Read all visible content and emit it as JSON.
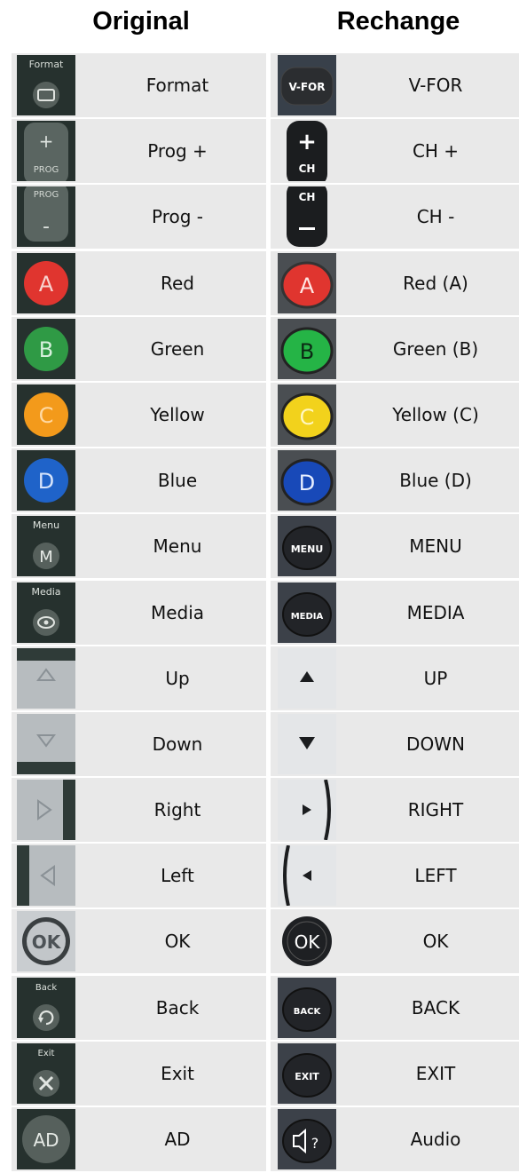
{
  "headers": {
    "original": "Original",
    "rechange": "Rechange"
  },
  "rows": [
    {
      "original": "Format",
      "rechange": "V-FOR",
      "orig_icon": "format-icon",
      "new_icon": "vfor-icon",
      "orig_text": "Format",
      "new_text": "V-FOR"
    },
    {
      "original": "Prog +",
      "rechange": "CH +",
      "orig_icon": "prog-plus-icon",
      "new_icon": "ch-plus-icon",
      "orig_text": "PROG",
      "new_text": "CH"
    },
    {
      "original": "Prog -",
      "rechange": "CH -",
      "orig_icon": "prog-minus-icon",
      "new_icon": "ch-minus-icon",
      "orig_text": "PROG",
      "new_text": "CH"
    },
    {
      "original": "Red",
      "rechange": "Red (A)",
      "orig_icon": "red-a-icon",
      "new_icon": "red-a-icon",
      "orig_text": "A",
      "new_text": "A"
    },
    {
      "original": "Green",
      "rechange": "Green (B)",
      "orig_icon": "green-b-icon",
      "new_icon": "green-b-icon",
      "orig_text": "B",
      "new_text": "B"
    },
    {
      "original": "Yellow",
      "rechange": "Yellow (C)",
      "orig_icon": "yellow-c-icon",
      "new_icon": "yellow-c-icon",
      "orig_text": "C",
      "new_text": "C"
    },
    {
      "original": "Blue",
      "rechange": "Blue (D)",
      "orig_icon": "blue-d-icon",
      "new_icon": "blue-d-icon",
      "orig_text": "D",
      "new_text": "D"
    },
    {
      "original": "Menu",
      "rechange": "MENU",
      "orig_icon": "menu-icon",
      "new_icon": "menu-icon",
      "orig_text": "Menu",
      "new_text": "MENU"
    },
    {
      "original": "Media",
      "rechange": "MEDIA",
      "orig_icon": "media-icon",
      "new_icon": "media-icon",
      "orig_text": "Media",
      "new_text": "MEDIA"
    },
    {
      "original": "Up",
      "rechange": "UP",
      "orig_icon": "arrow-up-icon",
      "new_icon": "arrow-up-icon"
    },
    {
      "original": "Down",
      "rechange": "DOWN",
      "orig_icon": "arrow-down-icon",
      "new_icon": "arrow-down-icon"
    },
    {
      "original": "Right",
      "rechange": "RIGHT",
      "orig_icon": "arrow-right-icon",
      "new_icon": "arrow-right-icon"
    },
    {
      "original": "Left",
      "rechange": "LEFT",
      "orig_icon": "arrow-left-icon",
      "new_icon": "arrow-left-icon"
    },
    {
      "original": "OK",
      "rechange": "OK",
      "orig_icon": "ok-icon",
      "new_icon": "ok-icon",
      "orig_text": "OK",
      "new_text": "OK"
    },
    {
      "original": "Back",
      "rechange": "BACK",
      "orig_icon": "back-icon",
      "new_icon": "back-icon",
      "orig_text": "Back",
      "new_text": "BACK"
    },
    {
      "original": "Exit",
      "rechange": "EXIT",
      "orig_icon": "exit-icon",
      "new_icon": "exit-icon",
      "orig_text": "Exit",
      "new_text": "EXIT"
    },
    {
      "original": "AD",
      "rechange": "Audio",
      "orig_icon": "ad-icon",
      "new_icon": "audio-description-icon",
      "orig_text": "AD"
    }
  ],
  "colors": {
    "cell_bg": "#e9e9e9",
    "remote_dark": "#1c2624",
    "red": "#e0352f",
    "green": "#2f9a45",
    "yellow": "#f2d21c",
    "orange": "#f39a1b",
    "blue": "#1f63c9",
    "silver": "#c9cdd0"
  }
}
